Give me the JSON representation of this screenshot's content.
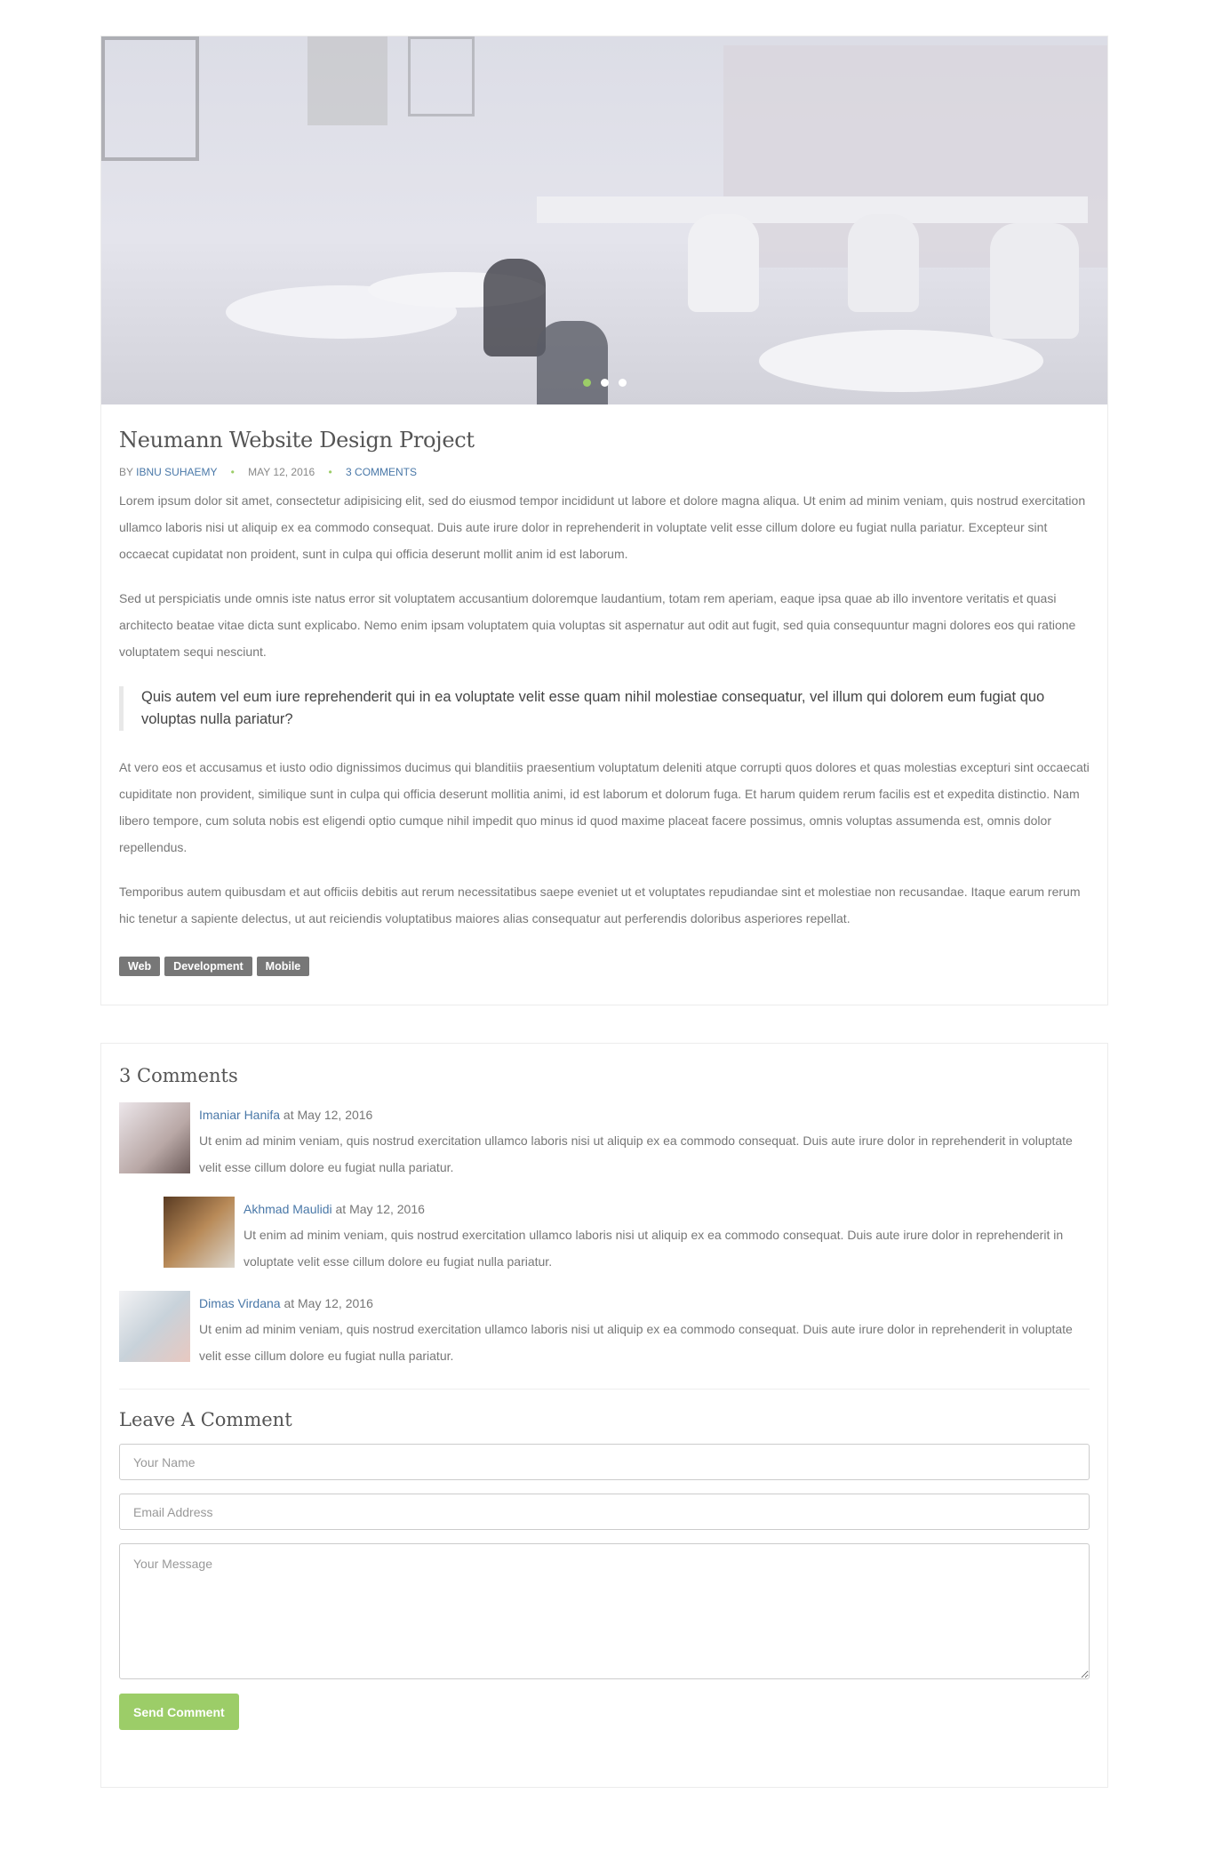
{
  "post": {
    "title": "Neumann Website Design Project",
    "meta": {
      "by": "BY",
      "author": "IBNU SUHAEMY",
      "date": "MAY 12, 2016",
      "comments": "3 COMMENTS"
    },
    "slider": {
      "dot_count": 3,
      "active_index": 0,
      "active_color": "#9ccd68"
    },
    "paragraphs": [
      "Lorem ipsum dolor sit amet, consectetur adipisicing elit, sed do eiusmod tempor incididunt ut labore et dolore magna aliqua. Ut enim ad minim veniam, quis nostrud exercitation ullamco laboris nisi ut aliquip ex ea commodo consequat. Duis aute irure dolor in reprehenderit in voluptate velit esse cillum dolore eu fugiat nulla pariatur. Excepteur sint occaecat cupidatat non proident, sunt in culpa qui officia deserunt mollit anim id est laborum.",
      "Sed ut perspiciatis unde omnis iste natus error sit voluptatem accusantium doloremque laudantium, totam rem aperiam, eaque ipsa quae ab illo inventore veritatis et quasi architecto beatae vitae dicta sunt explicabo. Nemo enim ipsam voluptatem quia voluptas sit aspernatur aut odit aut fugit, sed quia consequuntur magni dolores eos qui ratione voluptatem sequi nesciunt.",
      "At vero eos et accusamus et iusto odio dignissimos ducimus qui blanditiis praesentium voluptatum deleniti atque corrupti quos dolores et quas molestias excepturi sint occaecati cupiditate non provident, similique sunt in culpa qui officia deserunt mollitia animi, id est laborum et dolorum fuga. Et harum quidem rerum facilis est et expedita distinctio. Nam libero tempore, cum soluta nobis est eligendi optio cumque nihil impedit quo minus id quod maxime placeat facere possimus, omnis voluptas assumenda est, omnis dolor repellendus.",
      "Temporibus autem quibusdam et aut officiis debitis aut rerum necessitatibus saepe eveniet ut et voluptates repudiandae sint et molestiae non recusandae. Itaque earum rerum hic tenetur a sapiente delectus, ut aut reiciendis voluptatibus maiores alias consequatur aut perferendis doloribus asperiores repellat."
    ],
    "quote": "Quis autem vel eum iure reprehenderit qui in ea voluptate velit esse quam nihil molestiae consequatur, vel illum qui dolorem eum fugiat quo voluptas nulla pariatur?",
    "tags": [
      "Web",
      "Development",
      "Mobile"
    ]
  },
  "comments": {
    "heading": "3 Comments",
    "items": [
      {
        "name": "Imaniar Hanifa",
        "at": " at May 12, 2016",
        "text": "Ut enim ad minim veniam, quis nostrud exercitation ullamco laboris nisi ut aliquip ex ea commodo consequat. Duis aute irure dolor in reprehenderit in voluptate velit esse cillum dolore eu fugiat nulla pariatur."
      },
      {
        "name": "Akhmad Maulidi",
        "at": " at May 12, 2016",
        "text": "Ut enim ad minim veniam, quis nostrud exercitation ullamco laboris nisi ut aliquip ex ea commodo consequat. Duis aute irure dolor in reprehenderit in voluptate velit esse cillum dolore eu fugiat nulla pariatur."
      },
      {
        "name": "Dimas Virdana",
        "at": " at May 12, 2016",
        "text": "Ut enim ad minim veniam, quis nostrud exercitation ullamco laboris nisi ut aliquip ex ea commodo consequat. Duis aute irure dolor in reprehenderit in voluptate velit esse cillum dolore eu fugiat nulla pariatur."
      }
    ]
  },
  "form": {
    "heading": "Leave A Comment",
    "name_placeholder": "Your Name",
    "email_placeholder": "Email Address",
    "message_placeholder": "Your Message",
    "submit": "Send Comment",
    "accent": "#9ccd68"
  }
}
